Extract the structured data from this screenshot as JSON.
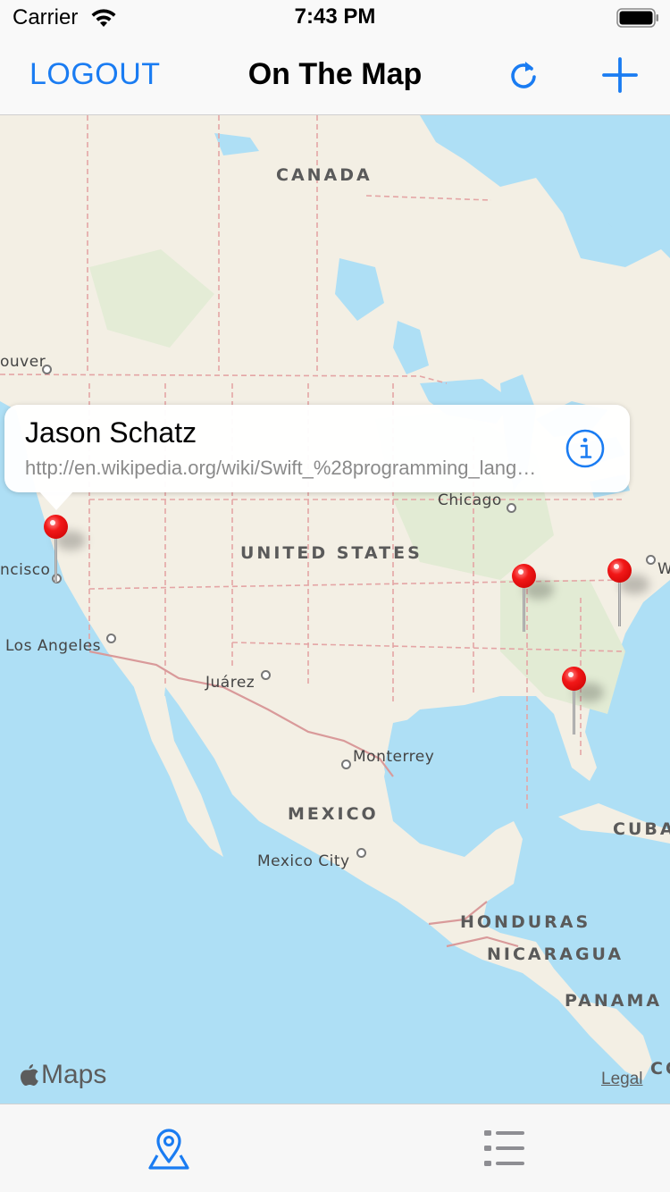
{
  "status_bar": {
    "carrier": "Carrier",
    "time": "7:43 PM"
  },
  "nav": {
    "logout_label": "LOGOUT",
    "title": "On The Map",
    "refresh_icon": "refresh-icon",
    "add_icon": "plus-icon",
    "accent_color": "#1a7cf2"
  },
  "map": {
    "countries": [
      "CANADA",
      "UNITED STATES",
      "MEXICO",
      "CUBA",
      "HONDURAS",
      "NICARAGUA",
      "PANAMA"
    ],
    "cities": [
      "Chicago",
      "Los Angeles",
      "Juárez",
      "Monterrey",
      "Mexico City"
    ],
    "partial_labels": [
      "ouver",
      "ncisco",
      "W",
      "CO"
    ],
    "attribution": "Maps",
    "legal": "Legal",
    "pin_color": "#e00000"
  },
  "callout": {
    "title": "Jason Schatz",
    "subtitle": "http://en.wikipedia.org/wiki/Swift_%28programming_language%29",
    "info_icon": "info-icon"
  },
  "tab_bar": {
    "items": [
      {
        "icon": "map-pin-icon",
        "selected": true
      },
      {
        "icon": "list-icon",
        "selected": false
      }
    ]
  }
}
